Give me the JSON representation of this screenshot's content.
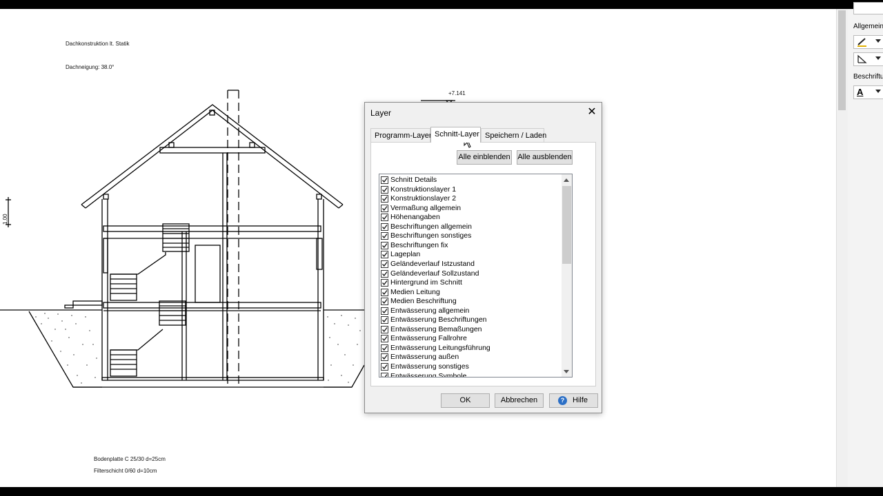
{
  "drawing": {
    "notes": {
      "roof_construction": "Dachkonstruktion lt. Statik",
      "roof_pitch": "Dachneigung: 38.0°",
      "floor_slab": "Bodenplatte C 25/30 d=25cm",
      "filter_layer": "Filterschicht 0/60 d=10cm"
    },
    "elevation_mark": "+7.141",
    "dimension_label": "1.00"
  },
  "palette": {
    "label_general": "Allgemein",
    "label_labeling": "Beschriftu",
    "text_tool_glyph": "A"
  },
  "dialog": {
    "title": "Layer",
    "close_glyph": "✕",
    "tabs": [
      {
        "label": "Programm-Layer",
        "active": false
      },
      {
        "label": "Schnitt-Layer",
        "active": true
      },
      {
        "label": "Speichern / Laden",
        "active": false
      }
    ],
    "show_all": "Alle einblenden",
    "hide_all": "Alle ausblenden",
    "layers": [
      {
        "label": "Schnitt Details",
        "checked": true
      },
      {
        "label": "Konstruktionslayer 1",
        "checked": true
      },
      {
        "label": "Konstruktionslayer 2",
        "checked": true
      },
      {
        "label": "Vermaßung allgemein",
        "checked": true
      },
      {
        "label": "Höhenangaben",
        "checked": true
      },
      {
        "label": "Beschriftungen allgemein",
        "checked": true
      },
      {
        "label": "Beschriftungen sonstiges",
        "checked": true
      },
      {
        "label": "Beschriftungen fix",
        "checked": true
      },
      {
        "label": "Lageplan",
        "checked": true
      },
      {
        "label": "Geländeverlauf Istzustand",
        "checked": true
      },
      {
        "label": "Geländeverlauf Sollzustand",
        "checked": true
      },
      {
        "label": "Hintergrund im Schnitt",
        "checked": true
      },
      {
        "label": "Medien Leitung",
        "checked": true
      },
      {
        "label": "Medien Beschriftung",
        "checked": true
      },
      {
        "label": "Entwässerung allgemein",
        "checked": true
      },
      {
        "label": "Entwässerung Beschriftungen",
        "checked": true
      },
      {
        "label": "Entwässerung Bemaßungen",
        "checked": true
      },
      {
        "label": "Entwässerung Fallrohre",
        "checked": true
      },
      {
        "label": "Entwässerung Leitungsführung",
        "checked": true
      },
      {
        "label": "Entwässerung außen",
        "checked": true
      },
      {
        "label": "Entwässerung sonstiges",
        "checked": true
      },
      {
        "label": "Entwässerung Symbole",
        "checked": true
      }
    ],
    "ok": "OK",
    "cancel": "Abbrechen",
    "help": "Hilfe",
    "help_glyph": "?"
  }
}
